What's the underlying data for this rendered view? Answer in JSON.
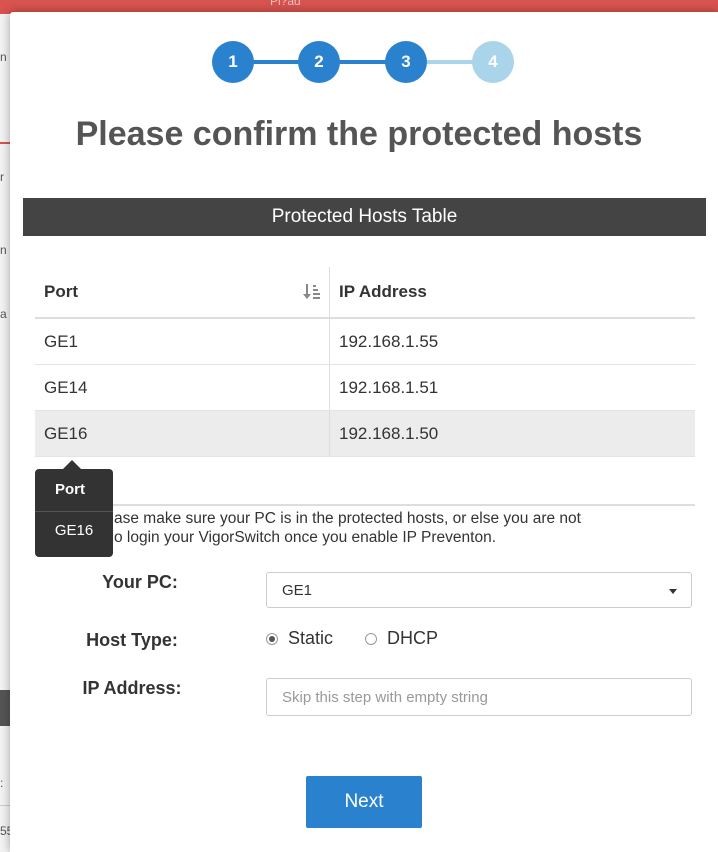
{
  "background": {
    "topbar_text": "Pl?ad",
    "strip_letters": [
      "n",
      "r",
      "n",
      "a",
      ":",
      "55"
    ]
  },
  "stepper": {
    "steps": [
      {
        "label": "1",
        "state": "done"
      },
      {
        "label": "2",
        "state": "done"
      },
      {
        "label": "3",
        "state": "done"
      },
      {
        "label": "4",
        "state": "todo"
      }
    ],
    "colors": {
      "done": "#2a82cf",
      "todo": "#a9d4ea"
    }
  },
  "title": "Please confirm the protected hosts",
  "table": {
    "caption": "Protected Hosts Table",
    "headers": {
      "port": "Port",
      "ip": "IP Address"
    },
    "sort_icon": "sort-numeric-desc-icon",
    "rows": [
      {
        "port": "GE1",
        "ip": "192.168.1.55"
      },
      {
        "port": "GE14",
        "ip": "192.168.1.51"
      },
      {
        "port": "GE16",
        "ip": "192.168.1.50"
      }
    ]
  },
  "tooltip": {
    "title": "Port",
    "value": "GE16"
  },
  "notice": {
    "line1": "ase make sure your PC is in the protected hosts, or else you are not",
    "line2": "o login your VigorSwitch once you enable IP Preventon."
  },
  "form": {
    "your_pc_label": "Your PC:",
    "your_pc_value": "GE1",
    "host_type_label": "Host Type:",
    "host_type_options": [
      {
        "label": "Static",
        "checked": true
      },
      {
        "label": "DHCP",
        "checked": false
      }
    ],
    "ip_label": "IP Address:",
    "ip_placeholder": "Skip this step with empty string",
    "ip_value": ""
  },
  "next_button": "Next"
}
